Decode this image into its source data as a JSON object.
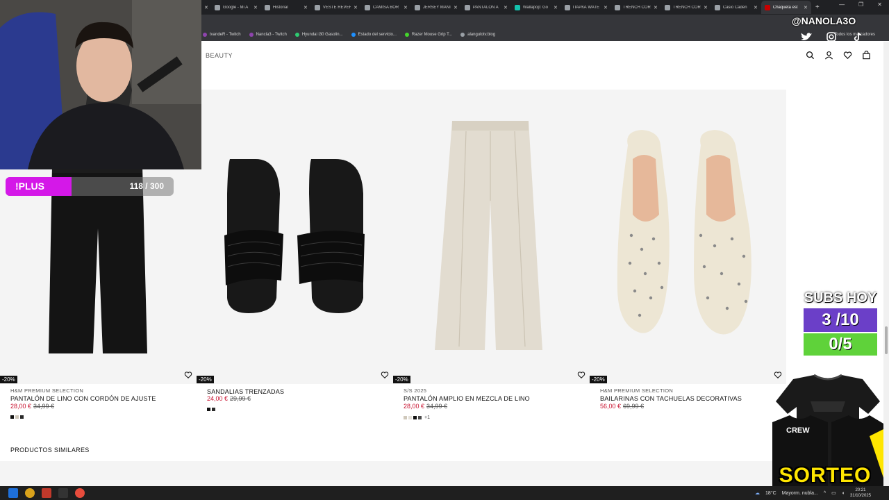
{
  "browser": {
    "tabs": [
      {
        "label": "Google - Mi A"
      },
      {
        "label": "Historial"
      },
      {
        "label": "VESTE RÊVER"
      },
      {
        "label": "CAMISA BOR"
      },
      {
        "label": "JERSEY MANI"
      },
      {
        "label": "PANTALÓN A"
      },
      {
        "label": "Wallapop: Go"
      },
      {
        "label": "ПАРКА WATE"
      },
      {
        "label": "TRENCH COR"
      },
      {
        "label": "TRENCH COR"
      },
      {
        "label": "Casio Caden"
      },
      {
        "label": "Chaqueta est"
      }
    ],
    "active_tab_index": 11,
    "bookmarks": [
      {
        "label": "tvandeR - Twitch"
      },
      {
        "label": "Nancla3 - Twitch"
      },
      {
        "label": "Hyundai i30 Gasolin..."
      },
      {
        "label": "Estado del servicio..."
      },
      {
        "label": "Razer Mouse Grip T..."
      },
      {
        "label": "alangulotv.blog"
      }
    ],
    "all_bookmarks": "Todos los marcadores"
  },
  "site": {
    "brand": "BEAUTY"
  },
  "products": [
    {
      "discount": "-20%",
      "subtitle": "H&M PREMIUM SELECTION",
      "name": "PANTALÓN DE LINO CON CORDÓN DE AJUSTE",
      "price": "28,00 €",
      "old_price": "34,99 €",
      "swatches": [
        "#111111",
        "#cfc8bb",
        "#2a2a2a"
      ],
      "more": ""
    },
    {
      "discount": "-20%",
      "subtitle": "",
      "name": "SANDALIAS TRENZADAS",
      "price": "24,00 €",
      "old_price": "29,99 €",
      "swatches": [
        "#111111",
        "#2a2a2a"
      ],
      "more": ""
    },
    {
      "discount": "-20%",
      "subtitle": "S/S 2025",
      "name": "PANTALÓN AMPLIO EN MEZCLA DE LINO",
      "price": "28,00 €",
      "old_price": "34,99 €",
      "swatches": [
        "#cfc8bb",
        "#e4e0d8",
        "#111111",
        "#4a4a4a"
      ],
      "more": "+1"
    },
    {
      "discount": "-20%",
      "subtitle": "H&M PREMIUM SELECTION",
      "name": "BAILARINAS CON TACHUELAS DECORATIVAS",
      "price": "56,00 €",
      "old_price": "69,99 €",
      "swatches": [],
      "more": ""
    }
  ],
  "similar_title": "PRODUCTOS SIMILARES",
  "overlay": {
    "plus_label": "!PLUS",
    "plus_count": "118 / 300",
    "plus_fraction": 0.393,
    "handle": "@NANOLA3O",
    "subs_title": "SUBS HOY",
    "subs_value": "3 /10",
    "goal_value": "0/5",
    "merch_label": "CREW",
    "sorteo": "SORTEO"
  },
  "taskbar": {
    "temp": "18°C",
    "weather": "Mayorm. nubla...",
    "time": "20:21",
    "date": "31/10/2025"
  },
  "colors": {
    "sale_red": "#c8102e",
    "plus_purple": "#d418e8",
    "subs_purple": "#6b3fc8",
    "goal_green": "#5fd23a",
    "sorteo_yellow": "#ffe600"
  }
}
